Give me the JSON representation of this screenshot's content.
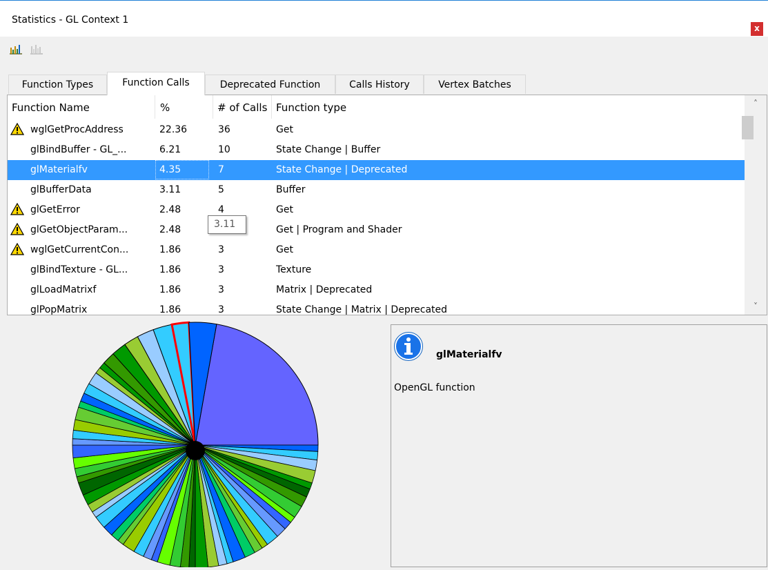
{
  "window": {
    "title": "Statistics - GL Context 1",
    "close_label": "x"
  },
  "toolbar": {
    "icons": [
      "bar-chart-icon",
      "bar-chart-disabled-icon"
    ]
  },
  "tabs": [
    "Function Types",
    "Function Calls",
    "Deprecated Function",
    "Calls History",
    "Vertex Batches"
  ],
  "active_tab": "Function Calls",
  "table": {
    "columns": [
      "Function Name",
      "%",
      "# of Calls",
      "Function type"
    ],
    "rows": [
      {
        "warning": true,
        "name": "wglGetProcAddress",
        "pct": "22.36",
        "calls": "36",
        "type": "Get"
      },
      {
        "warning": false,
        "name": "glBindBuffer - GL_...",
        "pct": "6.21",
        "calls": "10",
        "type": "State Change | Buffer"
      },
      {
        "warning": false,
        "name": "glMaterialfv",
        "pct": "4.35",
        "calls": "7",
        "type": "State Change | Deprecated",
        "selected": true
      },
      {
        "warning": false,
        "name": "glBufferData",
        "pct": "3.11",
        "calls": "5",
        "type": "Buffer"
      },
      {
        "warning": true,
        "name": "glGetError",
        "pct": "2.48",
        "calls": "4",
        "type": "Get"
      },
      {
        "warning": true,
        "name": "glGetObjectParam...",
        "pct": "2.48",
        "calls": "4",
        "type": "Get | Program and Shader"
      },
      {
        "warning": true,
        "name": "wglGetCurrentCon...",
        "pct": "1.86",
        "calls": "3",
        "type": "Get"
      },
      {
        "warning": false,
        "name": "glBindTexture - GL...",
        "pct": "1.86",
        "calls": "3",
        "type": "Texture"
      },
      {
        "warning": false,
        "name": "glLoadMatrixf",
        "pct": "1.86",
        "calls": "3",
        "type": "Matrix | Deprecated"
      },
      {
        "warning": false,
        "name": "glPopMatrix",
        "pct": "1.86",
        "calls": "3",
        "type": "State Change | Matrix | Deprecated"
      }
    ]
  },
  "tooltip": "3.11",
  "info": {
    "icon": "info-icon",
    "name": "glMaterialfv",
    "description": "OpenGL function"
  },
  "colors": {
    "selection": "#3399ff",
    "pie_big": "#6464ff",
    "pie_highlight": "#ff0000",
    "pie_palette": [
      "#0064ff",
      "#33ccff",
      "#99ccff",
      "#99cc33",
      "#009900",
      "#006600",
      "#339900",
      "#33cc33",
      "#66ff00",
      "#3366ff",
      "#6699ff",
      "#33ccff",
      "#99cc00",
      "#66cc33",
      "#00cc66"
    ]
  }
}
